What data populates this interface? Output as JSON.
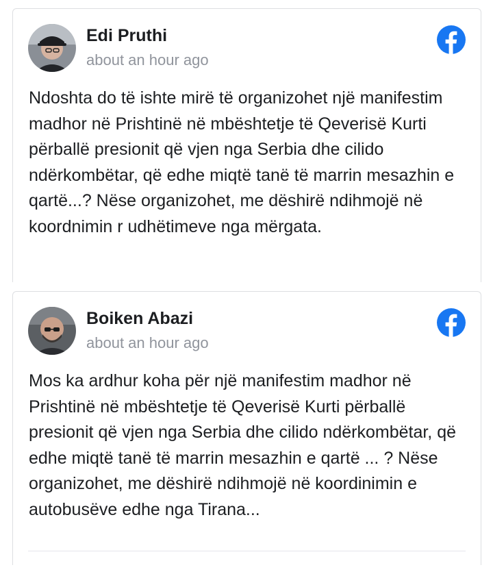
{
  "posts": [
    {
      "author": "Edi Pruthi",
      "timestamp": "about an hour ago",
      "text": "Ndoshta do të ishte mirë të organizohet një manifestim madhor në Prishtinë në mbështetje të Qeverisë Kurti përballë presionit që vjen nga Serbia dhe cilido ndërkombëtar, që edhe miqtë tanë të marrin mesazhin e qartë...? Nëse organizohet, me dëshirë ndihmojë në koordnimin r udhëtimeve nga mërgata.",
      "source_icon": "facebook-icon"
    },
    {
      "author": "Boiken Abazi",
      "timestamp": "about an hour ago",
      "text": "Mos ka ardhur koha për një manifestim madhor në Prishtinë në mbështetje të Qeverisë Kurti përballë presionit që vjen nga Serbia dhe cilido ndërkombëtar, që edhe miqtë tanë të marrin mesazhin e qartë ... ? Nëse organizohet, me dëshirë ndihmojë në koordinimin e autobusëve edhe nga Tirana...",
      "source_icon": "facebook-icon"
    }
  ],
  "colors": {
    "facebook_blue": "#1877f2",
    "name_text": "#1c1e21",
    "timestamp_text": "#90949c",
    "border": "#dddfe2"
  }
}
